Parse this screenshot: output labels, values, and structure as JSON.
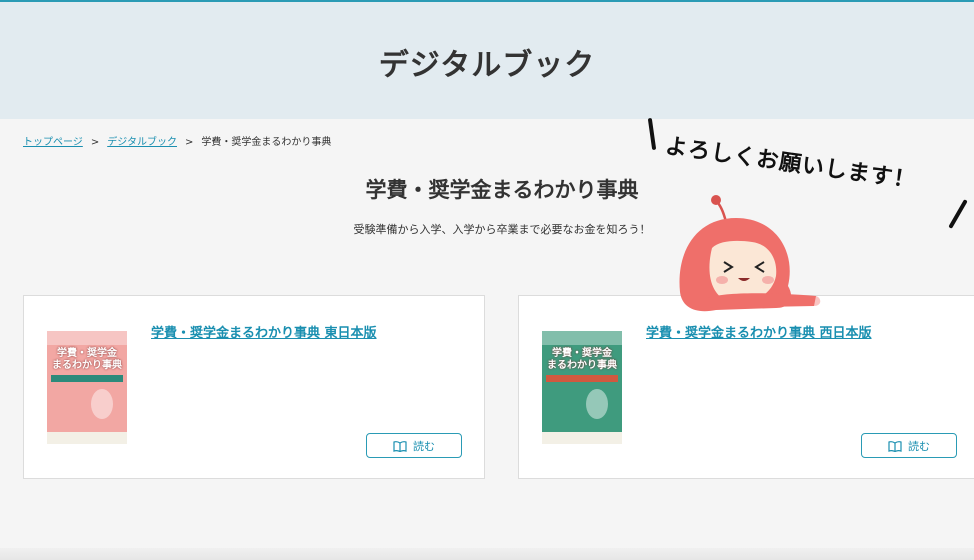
{
  "header": {
    "title": "デジタルブック"
  },
  "breadcrumb": {
    "items": [
      {
        "label": "トップページ"
      },
      {
        "label": "デジタルブック"
      },
      {
        "label": "学費・奨学金まるわかり事典"
      }
    ],
    "separator": ">"
  },
  "page": {
    "title": "学費・奨学金まるわかり事典",
    "lead": "受験準備から入学、入学から卒業まで必要なお金を知ろう！"
  },
  "books": [
    {
      "title": "学費・奨学金まるわかり事典 東日本版",
      "read_label": "読む",
      "cover_title": "学費・奨学金まるわかり事典",
      "cover_color": "#f2a7a3",
      "strip_color": "#2d8a7b"
    },
    {
      "title": "学費・奨学金まるわかり事典 西日本版",
      "read_label": "読む",
      "cover_title": "学費・奨学金まるわかり事典",
      "cover_color": "#3f9b7e",
      "strip_color": "#d0593f"
    }
  ],
  "mascot": {
    "speech": "よろしくお願いします！"
  },
  "colors": {
    "accent": "#1a8fb0",
    "header_bg": "#e2ebf0",
    "page_bg": "#f5f5f5",
    "mascot": "#ef6f6a"
  }
}
